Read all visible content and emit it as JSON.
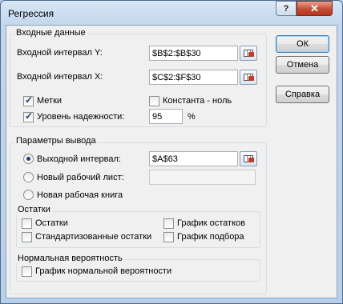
{
  "window": {
    "title": "Регрессия",
    "help_glyph": "?",
    "close_glyph": "✕"
  },
  "input": {
    "group_label": "Входные данные",
    "y_label": "Входной интервал Y:",
    "y_value": "$B$2:$B$30",
    "x_label": "Входной интервал X:",
    "x_value": "$C$2:$F$30",
    "labels_checkbox": {
      "label": "Метки",
      "checked": true
    },
    "constant_zero_checkbox": {
      "label": "Константа - ноль",
      "checked": false
    },
    "confidence_checkbox": {
      "label": "Уровень надежности:",
      "checked": true
    },
    "confidence_value": "95",
    "confidence_unit": "%"
  },
  "output": {
    "group_label": "Параметры вывода",
    "output_range_label": "Выходной интервал:",
    "output_range_value": "$A$63",
    "new_sheet_label": "Новый рабочий лист:",
    "new_sheet_value": "",
    "new_workbook_label": "Новая рабочая книга",
    "selected": "output_range"
  },
  "residuals": {
    "group_label": "Остатки",
    "residuals": "Остатки",
    "standardized": "Стандартизованные остатки",
    "residual_plots": "График остатков",
    "line_fit_plots": "График подбора"
  },
  "normal": {
    "group_label": "Нормальная вероятность",
    "normal_plot": "График нормальной вероятности"
  },
  "buttons": {
    "ok": "ОК",
    "cancel": "Отмена",
    "help": "Справка"
  },
  "colors": {
    "close_button": "#c74c34",
    "frame": "#bcd3ec",
    "dialog_bg": "#f0f0f0"
  }
}
